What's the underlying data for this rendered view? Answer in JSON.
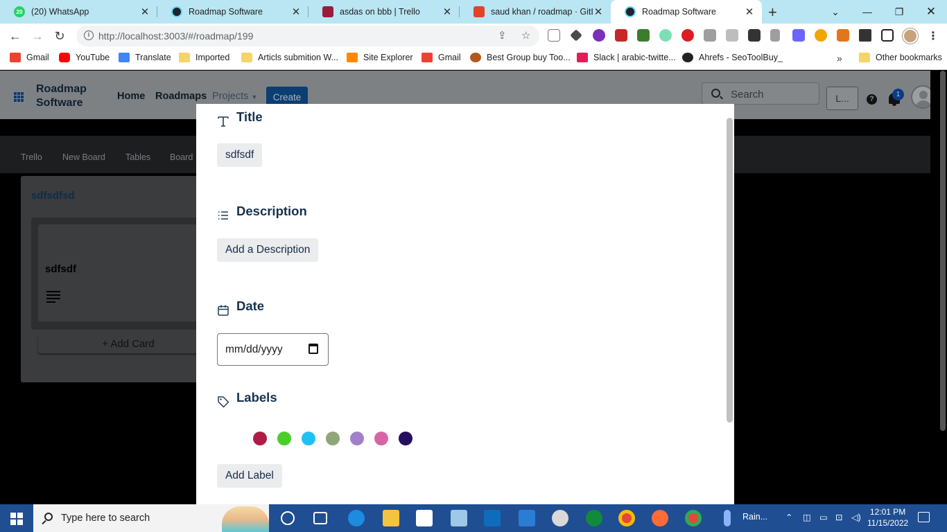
{
  "browser": {
    "tabs": [
      {
        "title": "(20) WhatsApp",
        "badge": "20",
        "icon": "whatsapp-icon",
        "color": "#25d366"
      },
      {
        "title": "Roadmap Software",
        "icon": "react-icon",
        "color": "#20232a"
      },
      {
        "title": "asdas on bbb | Trello",
        "icon": "trello-icon",
        "color": "#9b1c3a"
      },
      {
        "title": "saud khan / roadmap · GitLab",
        "icon": "gitlab-icon",
        "color": "#e24329"
      },
      {
        "title": "Roadmap Software",
        "icon": "react-icon",
        "color": "#20232a"
      }
    ],
    "url": "http://localhost:3003/#/roadmap/199",
    "bookmarks": [
      {
        "label": "Gmail",
        "icon": "gmail-icon",
        "color": "#ea4335"
      },
      {
        "label": "YouTube",
        "icon": "youtube-icon",
        "color": "#ff0000"
      },
      {
        "label": "Translate",
        "icon": "translate-icon",
        "color": "#4285f4"
      },
      {
        "label": "Imported",
        "icon": "folder-icon",
        "color": "#f5d46a"
      },
      {
        "label": "Articls submition W...",
        "icon": "folder-icon",
        "color": "#f5d46a"
      },
      {
        "label": "Site Explorer",
        "icon": "ahrefs-icon",
        "color": "#ff8800"
      },
      {
        "label": "Gmail",
        "icon": "gmail-icon",
        "color": "#ea4335"
      },
      {
        "label": "Best Group buy Too...",
        "icon": "groupbuy-icon",
        "color": "#b05a1e"
      },
      {
        "label": "Slack | arabic-twitte...",
        "icon": "slack-icon",
        "color": "#e01e5a"
      },
      {
        "label": "Ahrefs - SeoToolBuy_",
        "icon": "globe-icon",
        "color": "#222222"
      }
    ],
    "more_bookmarks": "»",
    "other_bookmarks": "Other bookmarks"
  },
  "app": {
    "brand": "Roadmap Software",
    "nav": {
      "home": "Home",
      "roadmaps": "Roadmaps",
      "projects": "Projects",
      "create": "Create"
    },
    "search_placeholder": "Search",
    "user_button": "L...",
    "help": "?",
    "notification_count": "1",
    "subnav": [
      "Trello",
      "New Board",
      "Tables",
      "Board"
    ],
    "column": {
      "title": "sdfsdfsd",
      "card_title": "sdfsdf",
      "add_card": "+ Add Card"
    }
  },
  "modal": {
    "title_heading": "Title",
    "title_value": "sdfsdf",
    "description_heading": "Description",
    "description_button": "Add a Description",
    "date_heading": "Date",
    "date_placeholder": "mm/dd/yyyy",
    "labels_heading": "Labels",
    "label_colors": [
      "#ad1d45",
      "#4ace2a",
      "#1fc1f5",
      "#8fa57a",
      "#a180cb",
      "#d864a7",
      "#230f5e"
    ],
    "add_label_button": "Add Label"
  },
  "taskbar": {
    "search_placeholder": "Type here to search",
    "weather": "Rain...",
    "time": "12:01 PM",
    "date": "11/15/2022"
  }
}
